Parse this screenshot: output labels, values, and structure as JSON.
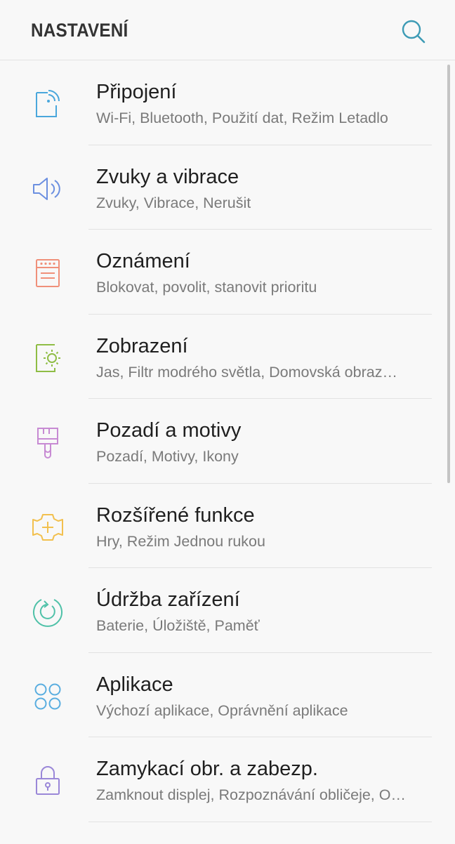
{
  "header": {
    "title": "NASTAVENÍ",
    "search_icon": "search-icon"
  },
  "colors": {
    "accent": "#3d9bb5",
    "title_text": "#1f1f1f",
    "subtitle_text": "#7a7a7a"
  },
  "settings": {
    "items": [
      {
        "title": "Připojení",
        "subtitle": "Wi-Fi, Bluetooth, Použití dat, Režim Letadlo",
        "icon": "connections-icon",
        "color": "#4aa7dc"
      },
      {
        "title": "Zvuky a vibrace",
        "subtitle": "Zvuky, Vibrace, Nerušit",
        "icon": "speaker-icon",
        "color": "#6b8fe0"
      },
      {
        "title": "Oznámení",
        "subtitle": "Blokovat, povolit, stanovit prioritu",
        "icon": "notifications-icon",
        "color": "#f0907a"
      },
      {
        "title": "Zobrazení",
        "subtitle": "Jas, Filtr modrého světla, Domovská obraz…",
        "icon": "display-icon",
        "color": "#8fbd45"
      },
      {
        "title": "Pozadí a motivy",
        "subtitle": "Pozadí, Motivy, Ikony",
        "icon": "paintbrush-icon",
        "color": "#c78ad3"
      },
      {
        "title": "Rozšířené funkce",
        "subtitle": "Hry, Režim Jednou rukou",
        "icon": "gear-plus-icon",
        "color": "#f2c04e"
      },
      {
        "title": "Údržba zařízení",
        "subtitle": "Baterie, Úložiště, Paměť",
        "icon": "device-care-icon",
        "color": "#4fc1a8"
      },
      {
        "title": "Aplikace",
        "subtitle": "Výchozí aplikace, Oprávnění aplikace",
        "icon": "apps-icon",
        "color": "#5aaee0"
      },
      {
        "title": "Zamykací obr. a zabezp.",
        "subtitle": "Zamknout displej, Rozpoznávání obličeje, O…",
        "icon": "lock-icon",
        "color": "#9a87d8"
      }
    ]
  }
}
